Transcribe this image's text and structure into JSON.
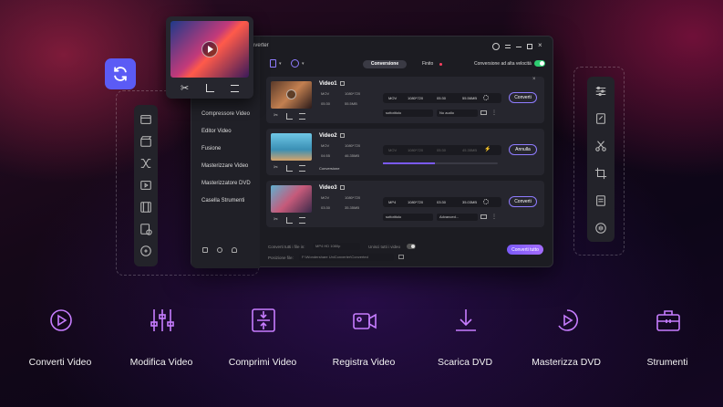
{
  "app": {
    "title": "nverter"
  },
  "tabs": {
    "conversion": "Conversione",
    "done": "Finito"
  },
  "high_speed": "Conversione ad alta velocità",
  "left_menu": [
    "Compressore Video",
    "Editor Video",
    "Fusione",
    "Masterizzare Video",
    "Masterizzatore DVD",
    "Casella Strumenti"
  ],
  "videos": [
    {
      "name": "Video1",
      "fmt": "MOV",
      "res": "1080*720",
      "dur": "05:30",
      "size": "55.5MB",
      "out_fmt": "MOV",
      "out_res": "1080*720",
      "out_dur": "05:30",
      "out_size": "55.56MB",
      "subtitle": "sottotitolo",
      "audio": "No audio",
      "action": "Converti"
    },
    {
      "name": "Video2",
      "fmt": "MOV",
      "res": "1080*720",
      "dur": "04:55",
      "size": "46.35MB",
      "out_fmt": "MOV",
      "out_res": "1080*720",
      "out_dur": "05:30",
      "out_size": "45.35MB",
      "status": "Conversione",
      "action": "Annulla"
    },
    {
      "name": "Video3",
      "fmt": "MOV",
      "res": "1080*720",
      "dur": "03:30",
      "size": "35.35MB",
      "out_fmt": "MP4",
      "out_res": "1080*720",
      "out_dur": "03:30",
      "out_size": "35.03MB",
      "subtitle": "sottotitolo",
      "audio": "Advanced...",
      "action": "Converti"
    }
  ],
  "footer": {
    "convert_all_label": "Converti tutti i file in:",
    "format": "MP4 HD 1080p",
    "merge": "Unisci tutti i video",
    "output_label": "Posizione file:",
    "output_path": "F:\\Wondershare UniConverter\\Converted",
    "convert_all": "Converti tutto"
  },
  "features": [
    "Converti Video",
    "Modifica Video",
    "Comprimi Video",
    "Registra Video",
    "Scarica DVD",
    "Masterizza DVD",
    "Strumenti"
  ],
  "colors": {
    "accent": "#7a5af8",
    "feature_icon": "#c77dff",
    "toggle": "#2ecc71"
  }
}
